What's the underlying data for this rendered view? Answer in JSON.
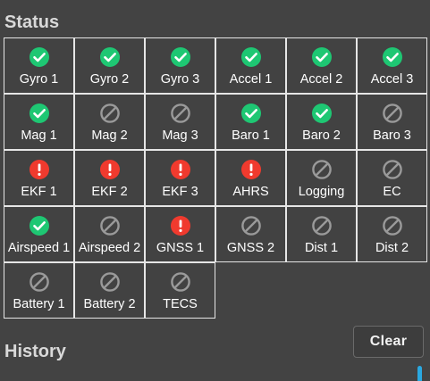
{
  "status": {
    "title": "Status",
    "items": [
      {
        "label": "Gyro 1",
        "state": "ok",
        "icon": "check-circle-icon"
      },
      {
        "label": "Gyro 2",
        "state": "ok",
        "icon": "check-circle-icon"
      },
      {
        "label": "Gyro 3",
        "state": "ok",
        "icon": "check-circle-icon"
      },
      {
        "label": "Accel 1",
        "state": "ok",
        "icon": "check-circle-icon"
      },
      {
        "label": "Accel 2",
        "state": "ok",
        "icon": "check-circle-icon"
      },
      {
        "label": "Accel 3",
        "state": "ok",
        "icon": "check-circle-icon"
      },
      {
        "label": "Mag 1",
        "state": "ok",
        "icon": "check-circle-icon"
      },
      {
        "label": "Mag 2",
        "state": "disabled",
        "icon": "disabled-icon"
      },
      {
        "label": "Mag 3",
        "state": "disabled",
        "icon": "disabled-icon"
      },
      {
        "label": "Baro 1",
        "state": "ok",
        "icon": "check-circle-icon"
      },
      {
        "label": "Baro 2",
        "state": "ok",
        "icon": "check-circle-icon"
      },
      {
        "label": "Baro 3",
        "state": "disabled",
        "icon": "disabled-icon"
      },
      {
        "label": "EKF 1",
        "state": "error",
        "icon": "alert-circle-icon"
      },
      {
        "label": "EKF 2",
        "state": "error",
        "icon": "alert-circle-icon"
      },
      {
        "label": "EKF 3",
        "state": "error",
        "icon": "alert-circle-icon"
      },
      {
        "label": "AHRS",
        "state": "error",
        "icon": "alert-circle-icon"
      },
      {
        "label": "Logging",
        "state": "disabled",
        "icon": "disabled-icon"
      },
      {
        "label": "EC",
        "state": "disabled",
        "icon": "disabled-icon"
      },
      {
        "label": "Airspeed 1",
        "state": "ok",
        "icon": "check-circle-icon"
      },
      {
        "label": "Airspeed 2",
        "state": "disabled",
        "icon": "disabled-icon"
      },
      {
        "label": "GNSS 1",
        "state": "error",
        "icon": "alert-circle-icon"
      },
      {
        "label": "GNSS 2",
        "state": "disabled",
        "icon": "disabled-icon"
      },
      {
        "label": "Dist 1",
        "state": "disabled",
        "icon": "disabled-icon"
      },
      {
        "label": "Dist 2",
        "state": "disabled",
        "icon": "disabled-icon"
      },
      {
        "label": "Battery 1",
        "state": "disabled",
        "icon": "disabled-icon"
      },
      {
        "label": "Battery 2",
        "state": "disabled",
        "icon": "disabled-icon"
      },
      {
        "label": "TECS",
        "state": "disabled",
        "icon": "disabled-icon"
      }
    ]
  },
  "history": {
    "title": "History",
    "clear_label": "Clear"
  },
  "colors": {
    "ok": "#1ec773",
    "error": "#f03a2e",
    "disabled": "#9a9a9a",
    "accent": "#2aa8e0"
  }
}
